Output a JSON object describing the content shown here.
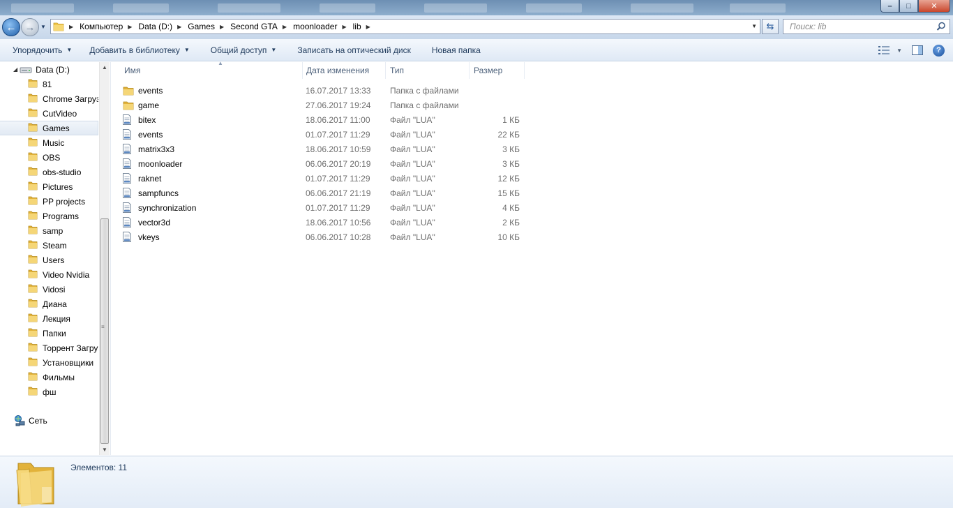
{
  "window": {
    "min_label": "–",
    "max_label": "□",
    "close_label": "✕"
  },
  "navigation": {
    "back_icon": "back-arrow-icon",
    "forward_icon": "forward-arrow-icon",
    "breadcrumbs": [
      "Компьютер",
      "Data (D:)",
      "Games",
      "Second GTA",
      "moonloader",
      "lib"
    ],
    "search_placeholder": "Поиск: lib"
  },
  "commands": {
    "organize": "Упорядочить",
    "add_to_library": "Добавить в библиотеку",
    "share": "Общий доступ",
    "burn": "Записать на оптический диск",
    "new_folder": "Новая папка",
    "help": "?"
  },
  "tree": {
    "drive": "Data (D:)",
    "folders": [
      "81",
      "Chrome Загрузки",
      "CutVideo",
      "Games",
      "Music",
      "OBS",
      "obs-studio",
      "Pictures",
      "PP projects",
      "Programs",
      "samp",
      "Steam",
      "Users",
      "Video Nvidia",
      "Vidosi",
      "Диана",
      "Лекция",
      "Папки",
      "Торрент Загрузки",
      "Установщики",
      "Фильмы",
      "фш"
    ],
    "selected": "Games",
    "network": "Сеть"
  },
  "columns": {
    "name": "Имя",
    "date": "Дата изменения",
    "type": "Тип",
    "size": "Размер"
  },
  "files": [
    {
      "name": "events",
      "date": "16.07.2017 13:33",
      "type": "Папка с файлами",
      "size": "",
      "kind": "folder"
    },
    {
      "name": "game",
      "date": "27.06.2017 19:24",
      "type": "Папка с файлами",
      "size": "",
      "kind": "folder"
    },
    {
      "name": "bitex",
      "date": "18.06.2017 11:00",
      "type": "Файл \"LUA\"",
      "size": "1 КБ",
      "kind": "file"
    },
    {
      "name": "events",
      "date": "01.07.2017 11:29",
      "type": "Файл \"LUA\"",
      "size": "22 КБ",
      "kind": "file"
    },
    {
      "name": "matrix3x3",
      "date": "18.06.2017 10:59",
      "type": "Файл \"LUA\"",
      "size": "3 КБ",
      "kind": "file"
    },
    {
      "name": "moonloader",
      "date": "06.06.2017 20:19",
      "type": "Файл \"LUA\"",
      "size": "3 КБ",
      "kind": "file"
    },
    {
      "name": "raknet",
      "date": "01.07.2017 11:29",
      "type": "Файл \"LUA\"",
      "size": "12 КБ",
      "kind": "file"
    },
    {
      "name": "sampfuncs",
      "date": "06.06.2017 21:19",
      "type": "Файл \"LUA\"",
      "size": "15 КБ",
      "kind": "file"
    },
    {
      "name": "synchronization",
      "date": "01.07.2017 11:29",
      "type": "Файл \"LUA\"",
      "size": "4 КБ",
      "kind": "file"
    },
    {
      "name": "vector3d",
      "date": "18.06.2017 10:56",
      "type": "Файл \"LUA\"",
      "size": "2 КБ",
      "kind": "file"
    },
    {
      "name": "vkeys",
      "date": "06.06.2017 10:28",
      "type": "Файл \"LUA\"",
      "size": "10 КБ",
      "kind": "file"
    }
  ],
  "status": {
    "item_count": "Элементов: 11"
  },
  "colors": {
    "accent": "#1e395b",
    "folder": "#f0c64a",
    "selection": "#e2eaf4"
  }
}
